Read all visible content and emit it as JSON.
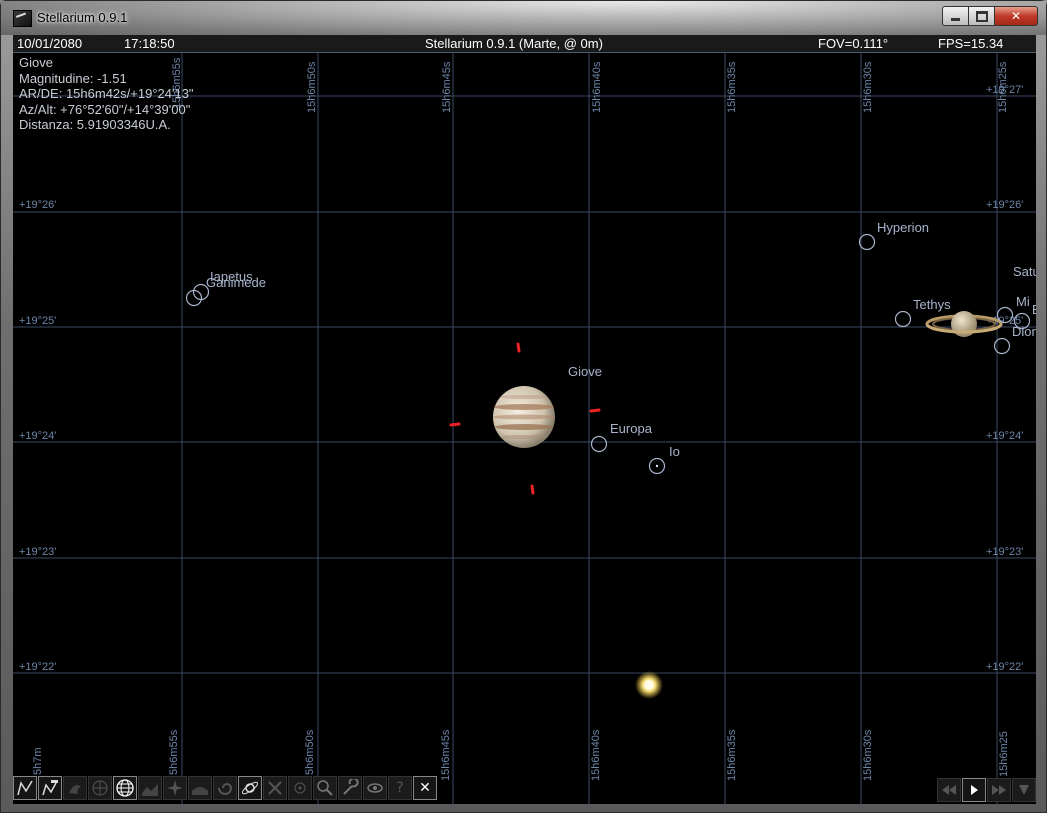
{
  "window": {
    "title": "Stellarium 0.9.1"
  },
  "topbar": {
    "date": "10/01/2080",
    "time": "17:18:50",
    "location": "Stellarium 0.9.1 (Marte,  @ 0m)",
    "fov": "FOV=0.111°",
    "fps": "FPS=15.34"
  },
  "info": {
    "name": "Giove",
    "magnitude": "Magnitudine: -1.51",
    "ra_de": "AR/DE: 15h6m42s/+19°24'13\"",
    "az_alt": "Az/Alt: +76°52'60\"/+14°39'00\"",
    "distance": "Distanza: 5.91903346U.A."
  },
  "grid": {
    "ra_top": [
      "15h6m55s",
      "15h6m50s",
      "15h6m45s",
      "15h6m40s",
      "15h6m35s",
      "15h6m30s",
      "15h6m25s"
    ],
    "ra_bottom": [
      "5h7m",
      "5h6m55s",
      "5h6m50s",
      "15h6m45s",
      "15h6m40s",
      "15h6m35s",
      "15h6m30s",
      "15h6m25"
    ],
    "dec_left": [
      "+19°26'",
      "+19°25'",
      "+19°24'",
      "+19°23'",
      "+19°22'"
    ],
    "dec_right": [
      "+19°27'",
      "+19°26'",
      "+19°25'",
      "+19°24'",
      "+19°23'",
      "+19°22'"
    ]
  },
  "objects": {
    "giove": "Giove",
    "europa": "Europa",
    "io": "Io",
    "ganimede": "Ganimede",
    "iapetus": "Iapetus",
    "hyperion": "Hyperion",
    "tethys": "Tethys",
    "saturn": "Satu",
    "mimas": "Mi",
    "dione": "Dion",
    "enceladus": "E"
  },
  "colors": {
    "sky": "#000000",
    "grid": "#3a4a66",
    "label": "#a8b4cc",
    "pointer": "#ee2222"
  },
  "toolbar": {
    "left_icons": [
      "constellation-lines-icon",
      "constellation-names-icon",
      "constellation-art-icon",
      "equatorial-grid-icon",
      "azimuthal-grid-icon",
      "ground-icon",
      "cardinal-points-icon",
      "atmosphere-icon",
      "nebulae-icon",
      "planets-icon",
      "telescope-icon",
      "center-icon",
      "search-icon",
      "config-icon",
      "night-mode-icon",
      "help-icon",
      "quit-icon"
    ],
    "help_glyph": "?",
    "quit_glyph": "✕",
    "right_icons": [
      "rewind-icon",
      "play-icon",
      "fast-forward-icon",
      "real-time-icon"
    ]
  }
}
